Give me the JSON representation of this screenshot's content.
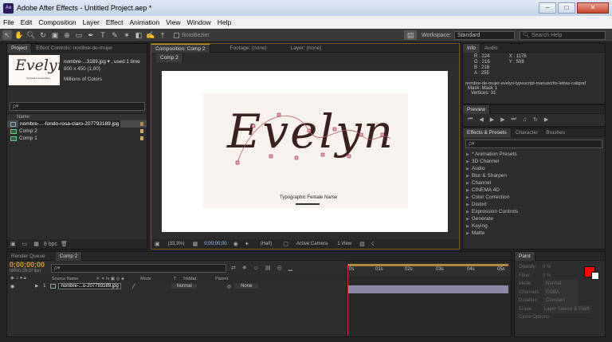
{
  "window": {
    "title": "Adobe After Effects - Untitled Project.aep *",
    "logo": "Ae",
    "buttons": [
      "–",
      "□",
      "✕"
    ]
  },
  "menu": [
    "File",
    "Edit",
    "Composition",
    "Layer",
    "Effect",
    "Animation",
    "View",
    "Window",
    "Help"
  ],
  "toolbar": {
    "rotobezier": "RotoBezier",
    "workspace_label": "Workspace:",
    "workspace_value": "Standard",
    "search_placeholder": "Search Help"
  },
  "project": {
    "tabs": [
      "Project",
      "Effect Controls: nombre-de-mujer"
    ],
    "thumb_text": "Evelyn",
    "thumb_caption": "Typographic Female Name",
    "file_name": "nombre-...3189.jpg ▾ , used 1 time",
    "file_size": "800 x 450 (1,00)",
    "file_colors": "Millions of Colors",
    "search_placeholder": "ρ▾",
    "column_name": "Name",
    "items": [
      {
        "name": "nombre-...-fondo-rosa-claro-207793189.jpg",
        "type": "file",
        "color": "#b08a5a"
      },
      {
        "name": "Comp 2",
        "type": "comp",
        "color": "#c8a868"
      },
      {
        "name": "Comp 1",
        "type": "comp",
        "color": "#c8a868"
      }
    ],
    "bpc": "8 bpc"
  },
  "composition": {
    "tabs": [
      "Composition: Comp 2",
      "Footage: (none)",
      "Layer: (none)"
    ],
    "subtab": "Comp 2",
    "artwork_title": "Evelyn",
    "artwork_caption": "Typographic Female Name",
    "bottom": {
      "zoom": "(33,3%)",
      "timecode": "0;00;00;00",
      "resolution": "(Half)",
      "camera": "Active Camera",
      "views": "1 View"
    }
  },
  "info": {
    "tabs": [
      "Info",
      "Audio"
    ],
    "r": "R : 224",
    "g": "G : 216",
    "b": "B : 218",
    "a": "A : 255",
    "x": "X : 1178",
    "y": "Y : 508",
    "layer": "nombre-de-mujer-evelyn-typescript-manuscrits-letras-caligraf",
    "mask": "Mask: Mask 1",
    "vertices": "Vertices: 31"
  },
  "preview": {
    "tab": "Preview"
  },
  "effects": {
    "tabs": [
      "Effects & Presets",
      "Character",
      "Brushes"
    ],
    "search_placeholder": "ρ▾",
    "items": [
      "* Animation Presets",
      "3D Channel",
      "Audio",
      "Blur & Sharpen",
      "Channel",
      "CINEMA 4D",
      "Color Correction",
      "Distort",
      "Expression Controls",
      "Generate",
      "Keying",
      "Matte"
    ]
  },
  "timeline": {
    "tabs": [
      "Render Queue",
      "Comp 2"
    ],
    "timecode": "0;00;00;00",
    "fps": "00000 (29.97 fps)",
    "search_placeholder": "ρ▾",
    "columns": {
      "source": "Source Name",
      "mode": "Mode",
      "t": "T",
      "trkmat": "TrkMat",
      "parent": "Parent"
    },
    "layer": {
      "index": "1",
      "name": "nombre-...o-207793189.jpg",
      "mode": "Normal",
      "parent": "None"
    },
    "ruler": [
      "0s",
      "01s",
      "02s",
      "03s",
      "04s",
      "05s"
    ]
  },
  "paint": {
    "tabs": [
      "Paint"
    ],
    "fields": [
      {
        "label": "Opacity:",
        "value": "0 %"
      },
      {
        "label": "Flow:",
        "value": "0 %"
      },
      {
        "label": "Mode:",
        "value": "Normal"
      },
      {
        "label": "Channels:",
        "value": "RGBA"
      },
      {
        "label": "Duration:",
        "value": "Constant"
      },
      {
        "label": "Erase:",
        "value": "Layer Source & Paint"
      },
      {
        "label": "Clone Options",
        "value": ""
      }
    ],
    "fg_color": "#ff0000",
    "bg_color": "#ffffff"
  }
}
